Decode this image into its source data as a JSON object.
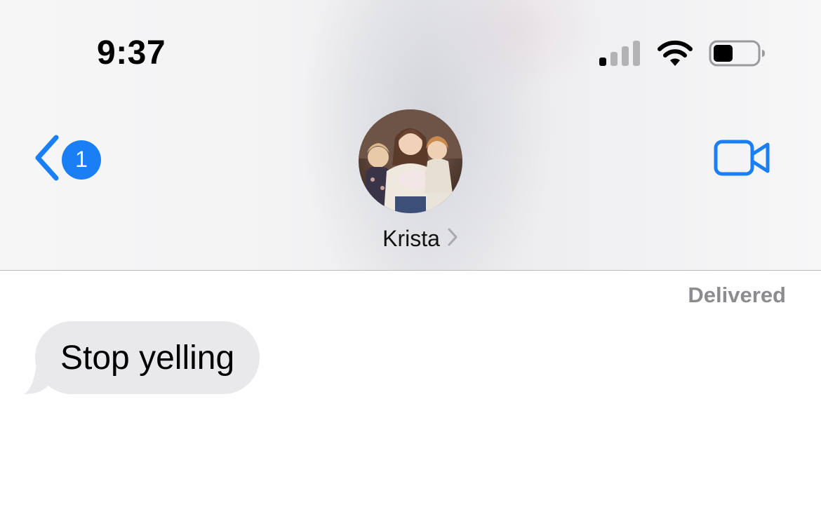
{
  "status_bar": {
    "time": "9:37",
    "signal_bars_filled": 1,
    "signal_bars_total": 4,
    "wifi_icon": "wifi-icon",
    "battery_level": 0.45
  },
  "nav": {
    "back_icon": "chevron-left-icon",
    "unread_count": "1",
    "contact_name": "Krista",
    "contact_chevron_icon": "chevron-right-icon",
    "video_icon": "video-camera-icon",
    "accent_color": "#1a7ff5"
  },
  "conversation": {
    "status_label": "Delivered",
    "messages": [
      {
        "direction": "incoming",
        "text": "Stop yelling"
      }
    ],
    "incoming_bubble_color": "#e9e9eb"
  }
}
